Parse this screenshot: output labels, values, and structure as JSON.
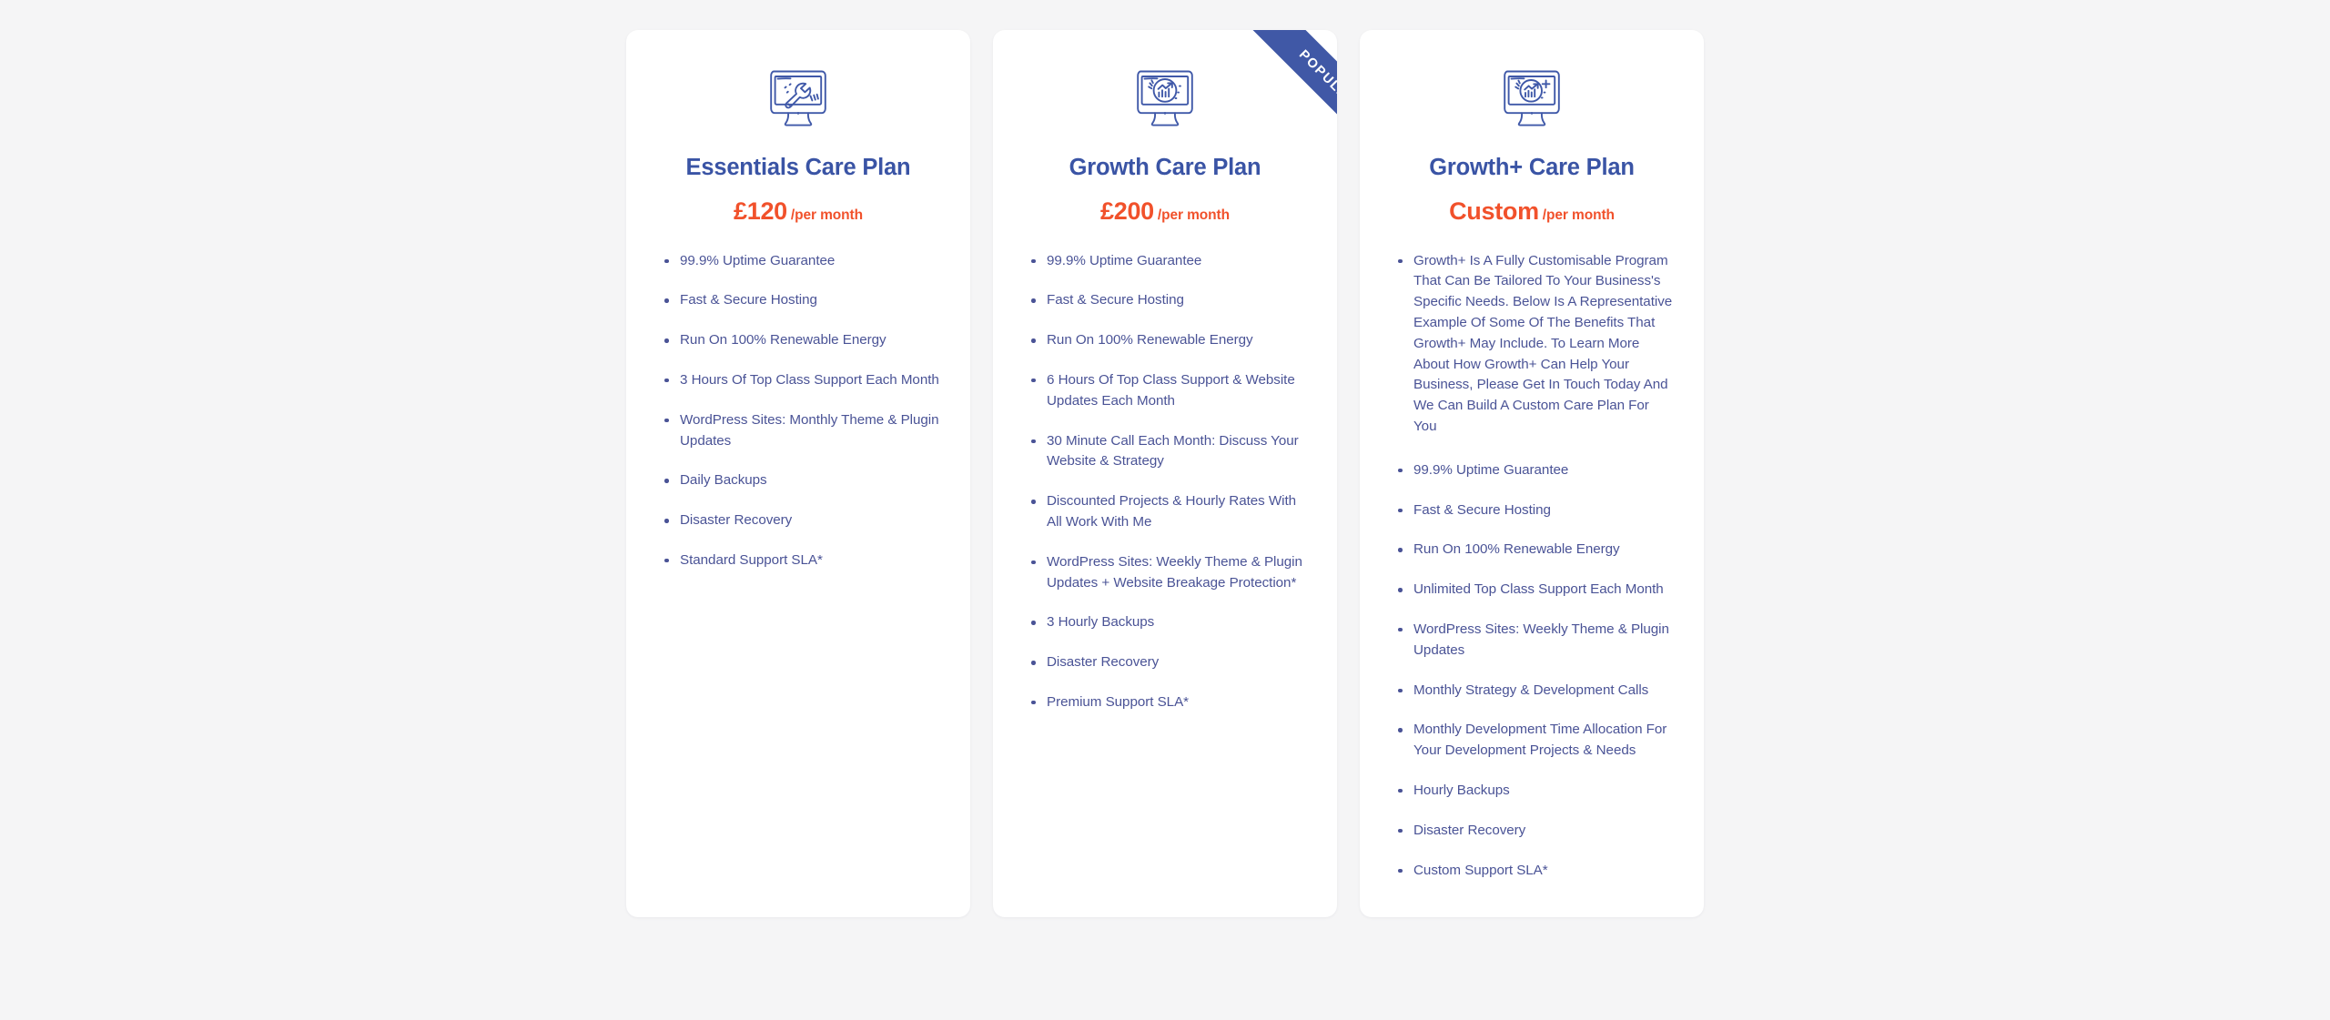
{
  "page": {
    "background_color": "#f5f5f6",
    "title_color": "#3a54a5",
    "price_color": "#f1512b",
    "feature_color": "#4a5396",
    "ribbon_color": "#4058a6"
  },
  "plans": [
    {
      "icon": "monitor-wrench-icon",
      "title": "Essentials Care Plan",
      "price": "£120",
      "period": "/per month",
      "ribbon": null,
      "features": [
        "99.9% Uptime Guarantee",
        "Fast & Secure Hosting",
        "Run On 100% Renewable Energy",
        "3 Hours Of Top Class Support Each Month",
        "WordPress Sites: Monthly Theme & Plugin Updates",
        "Daily Backups",
        "Disaster Recovery",
        "Standard Support SLA*"
      ]
    },
    {
      "icon": "monitor-growth-chart-icon",
      "title": "Growth Care Plan",
      "price": "£200",
      "period": "/per month",
      "ribbon": "POPULAR",
      "features": [
        "99.9% Uptime Guarantee",
        "Fast & Secure Hosting",
        "Run On 100% Renewable Energy",
        "6 Hours Of Top Class Support & Website Updates Each Month",
        "30 Minute Call Each Month: Discuss Your Website & Strategy",
        "Discounted Projects & Hourly Rates With All Work With Me",
        "WordPress Sites: Weekly Theme & Plugin Updates + Website Breakage Protection*",
        "3 Hourly Backups",
        "Disaster Recovery",
        "Premium Support SLA*"
      ]
    },
    {
      "icon": "monitor-growth-plus-icon",
      "title": "Growth+ Care Plan",
      "price": "Custom",
      "period": "/per month",
      "ribbon": null,
      "features": [
        "Growth+ Is A Fully Customisable Program That Can Be Tailored To Your Business's Specific Needs. Below Is A Representative Example Of Some Of The Benefits That Growth+ May Include. To Learn More About How Growth+ Can Help Your Business, Please Get In Touch Today And We Can Build A Custom Care Plan For You",
        "99.9% Uptime Guarantee",
        "Fast & Secure Hosting",
        "Run On 100% Renewable Energy",
        "Unlimited Top Class Support Each Month",
        "WordPress Sites: Weekly Theme & Plugin Updates",
        "Monthly Strategy & Development Calls",
        "Monthly Development Time Allocation For Your Development Projects & Needs",
        "Hourly Backups",
        "Disaster Recovery",
        "Custom Support SLA*"
      ]
    }
  ]
}
